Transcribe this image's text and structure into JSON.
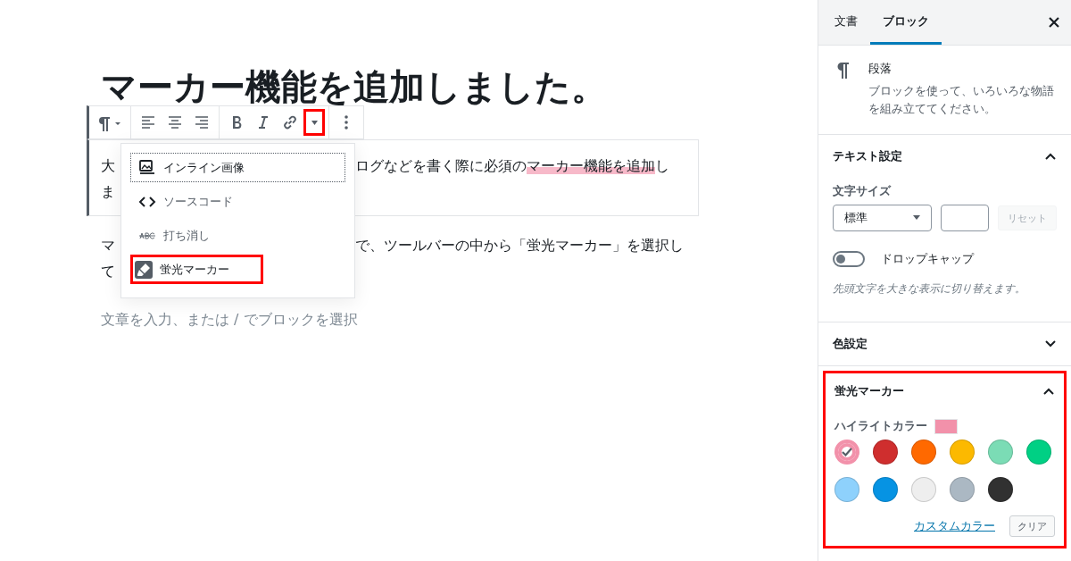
{
  "editor": {
    "title": "マーカー機能を追加しました。",
    "toolbar": [
      {
        "kind": "paragraph",
        "annotated": false
      },
      {
        "kind": "align-left",
        "annotated": false
      },
      {
        "kind": "align-center",
        "annotated": false
      },
      {
        "kind": "align-right",
        "annotated": false
      },
      {
        "kind": "bold",
        "annotated": false
      },
      {
        "kind": "italic",
        "annotated": false
      },
      {
        "kind": "link",
        "annotated": false
      },
      {
        "kind": "more",
        "annotated": true
      },
      {
        "kind": "options",
        "annotated": false
      }
    ],
    "paragraphs": [
      {
        "selected": true,
        "lines": [
          {
            "start": "大",
            "tail": [
              {
                "text": "ログなどを書く際に必須の",
                "highlight": false
              },
              {
                "text": "マーカー機能を追加",
                "highlight": true
              },
              {
                "text": "し",
                "highlight": false
              }
            ]
          },
          {
            "start": "ま"
          }
        ]
      },
      {
        "selected": false,
        "lines": [
          {
            "start": "マ",
            "tail": [
              {
                "text": "で、ツールバーの中から「蛍光マーカー」を選択し",
                "highlight": false
              }
            ]
          },
          {
            "start": "て"
          }
        ]
      }
    ],
    "placeholder": "文章を入力、または / でブロックを選択",
    "menu": [
      {
        "kind": "image",
        "label": "インライン画像",
        "focused": true,
        "annotated": false
      },
      {
        "kind": "code",
        "label": "ソースコード",
        "focused": false,
        "annotated": false
      },
      {
        "kind": "strike",
        "label": "打ち消し",
        "focused": false,
        "annotated": false
      },
      {
        "kind": "marker",
        "label": "蛍光マーカー",
        "focused": false,
        "annotated": true
      }
    ]
  },
  "sidebar": {
    "tabs": [
      {
        "label": "文書",
        "selected": false
      },
      {
        "label": "ブロック",
        "selected": true
      }
    ],
    "block": {
      "name": "段落",
      "description": "ブロックを使って、いろいろな物語を組み立ててください。"
    },
    "sections": [
      {
        "kind": "text",
        "title": "テキスト設定",
        "expanded": true,
        "annotated": false,
        "font_size_label": "文字サイズ",
        "font_size_value": "標準",
        "reset_label": "リセット",
        "reset_disabled": true,
        "toggle": {
          "label": "ドロップキャップ",
          "on": false
        },
        "help": "先頭文字を大きな表示に切り替えます。"
      },
      {
        "kind": "color",
        "title": "色設定",
        "expanded": false,
        "annotated": false
      },
      {
        "kind": "marker",
        "title": "蛍光マーカー",
        "expanded": true,
        "annotated": true,
        "label": "ハイライトカラー",
        "swatches": [
          {
            "color": "#f291aa",
            "selected": true
          },
          {
            "color": "#cf2e2e",
            "selected": false
          },
          {
            "color": "#ff6900",
            "selected": false
          },
          {
            "color": "#fcb900",
            "selected": false
          },
          {
            "color": "#7bdcb5",
            "selected": false
          },
          {
            "color": "#00d084",
            "selected": false
          },
          {
            "color": "#8ed1fc",
            "selected": false
          },
          {
            "color": "#0693e3",
            "selected": false
          },
          {
            "color": "#eeeeee",
            "selected": false
          },
          {
            "color": "#abb8c3",
            "selected": false
          },
          {
            "color": "#313131",
            "selected": false
          }
        ],
        "custom_link": "カスタムカラー",
        "clear_label": "クリア"
      }
    ]
  }
}
